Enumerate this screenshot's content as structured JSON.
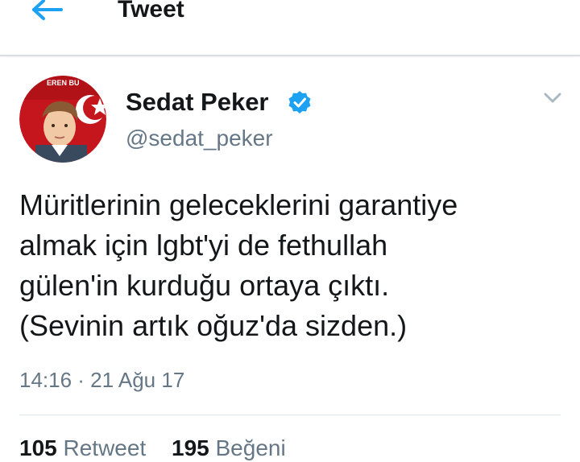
{
  "header": {
    "title": "Tweet",
    "back_icon": "arrow-left-icon",
    "accent_color": "#1da1f2"
  },
  "author": {
    "name": "Sedat Peker",
    "handle": "@sedat_peker",
    "verified": true,
    "verified_icon": "verified-badge-icon",
    "avatar_text": "EREN BU"
  },
  "tweet": {
    "lines": [
      "Müritlerinin geleceklerini garantiye",
      "almak için lgbt'yi de fethullah",
      "gülen'in kurduğu ortaya çıktı.",
      "(Sevinin artık oğuz'da sizden.)"
    ],
    "timestamp": "14:16 · 21 Ağu 17"
  },
  "stats": {
    "retweet_count": "105",
    "retweet_label": "Retweet",
    "like_count": "195",
    "like_label": "Beğeni"
  }
}
